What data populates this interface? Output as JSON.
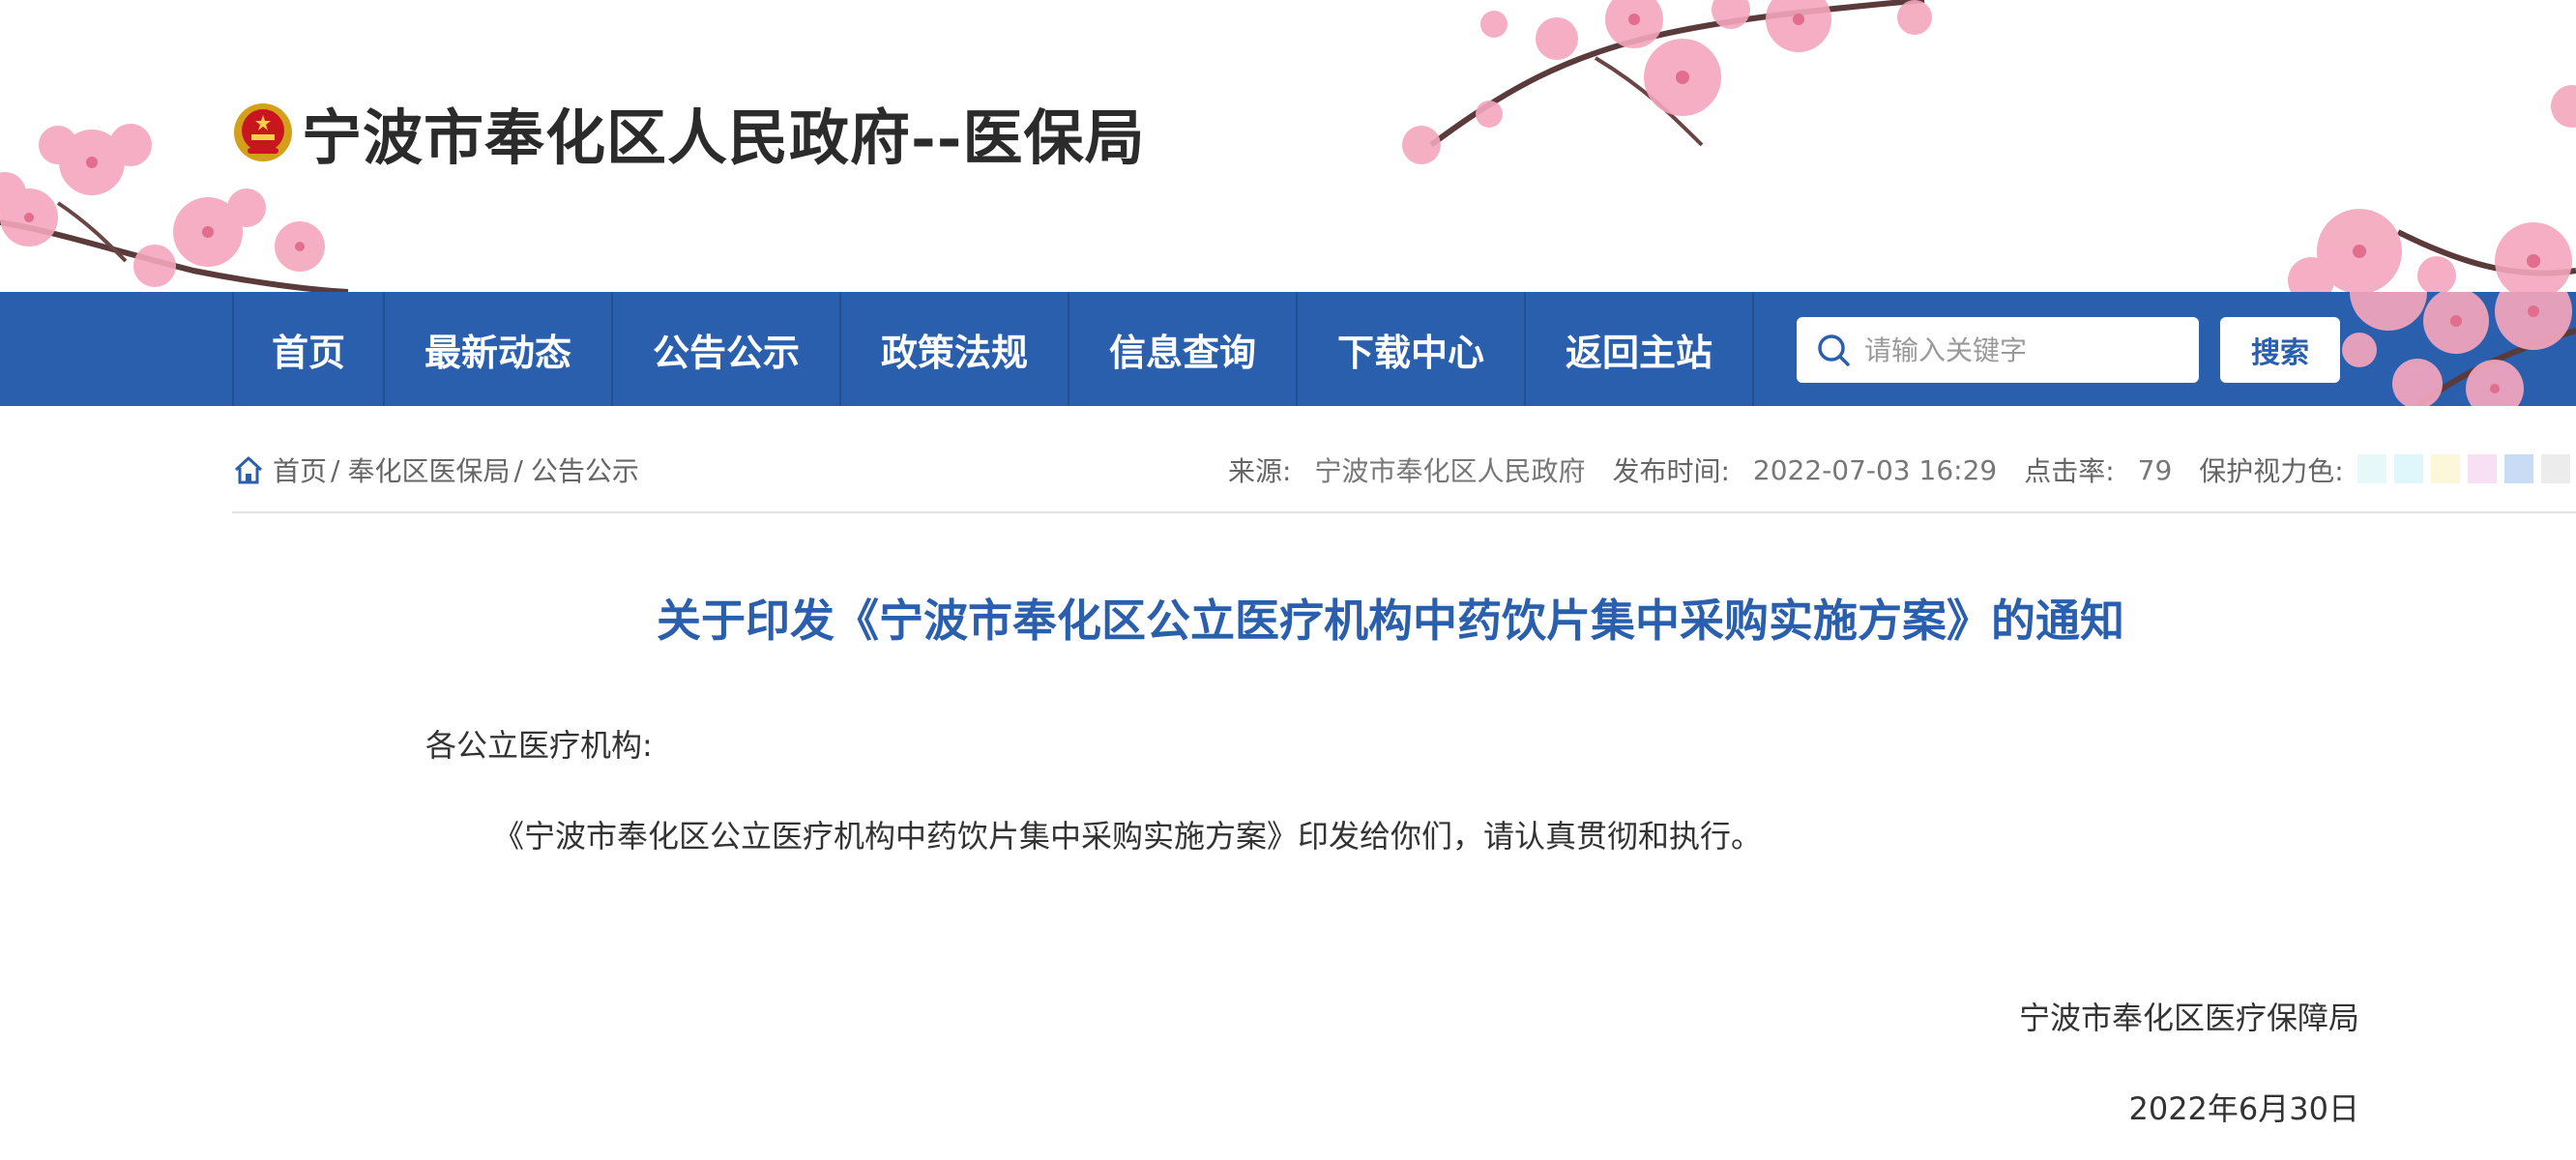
{
  "header": {
    "site_title": "宁波市奉化区人民政府--医保局"
  },
  "nav": {
    "items": [
      {
        "label": "首页"
      },
      {
        "label": "最新动态"
      },
      {
        "label": "公告公示"
      },
      {
        "label": "政策法规"
      },
      {
        "label": "信息查询"
      },
      {
        "label": "下载中心"
      },
      {
        "label": "返回主站"
      }
    ],
    "search_placeholder": "请输入关键字",
    "search_button": "搜索"
  },
  "breadcrumb": {
    "items": [
      "首页",
      "奉化区医保局",
      "公告公示"
    ],
    "separator": "/"
  },
  "meta": {
    "source_label": "来源:",
    "source_value": "宁波市奉化区人民政府",
    "date_label": "发布时间:",
    "date_value": "2022-07-03 16:29",
    "clicks_label": "点击率:",
    "clicks_value": "79",
    "eye_care_label": "保护视力色:",
    "eye_care_colors": [
      "#e6f8f8",
      "#dff6fb",
      "#fbf7d8",
      "#f7dff4",
      "#c9dcf5",
      "#ececec"
    ]
  },
  "article": {
    "title": "关于印发《宁波市奉化区公立医疗机构中药饮片集中采购实施方案》的通知",
    "salutation": "各公立医疗机构:",
    "body": "《宁波市奉化区公立医疗机构中药饮片集中采购实施方案》印发给你们，请认真贯彻和执行。",
    "signature": "宁波市奉化区医疗保障局",
    "date": "2022年6月30日"
  },
  "colors": {
    "nav_background": "#2a5fae",
    "title_blue": "#2a5fae",
    "blossom_pink": "#f4a6bd"
  },
  "icons": {
    "emblem": "national-emblem-icon",
    "search": "search-icon",
    "home": "home-icon"
  }
}
